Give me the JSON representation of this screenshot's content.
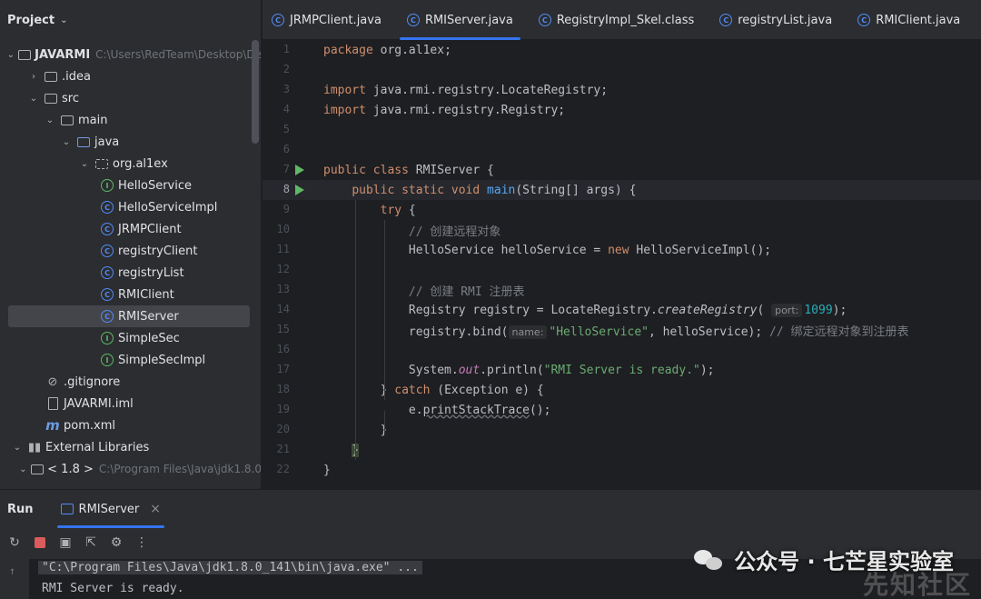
{
  "project": {
    "title": "Project",
    "tree": [
      {
        "label": "JAVARMI",
        "path": "C:\\Users\\RedTeam\\Desktop\\De",
        "depth": 0,
        "arrow": "down",
        "icon": "module-folder-icon",
        "bold": true
      },
      {
        "label": ".idea",
        "depth": 1,
        "arrow": "right",
        "icon": "folder-icon"
      },
      {
        "label": "src",
        "depth": 1,
        "arrow": "down",
        "icon": "folder-icon"
      },
      {
        "label": "main",
        "depth": 2,
        "arrow": "down",
        "icon": "folder-icon"
      },
      {
        "label": "java",
        "depth": 3,
        "arrow": "down",
        "icon": "source-folder-icon"
      },
      {
        "label": "org.al1ex",
        "depth": 4,
        "arrow": "down",
        "icon": "package-icon"
      },
      {
        "label": "HelloService",
        "depth": 5,
        "icon": "interface-icon"
      },
      {
        "label": "HelloServiceImpl",
        "depth": 5,
        "icon": "class-icon"
      },
      {
        "label": "JRMPClient",
        "depth": 5,
        "icon": "class-icon"
      },
      {
        "label": "registryClient",
        "depth": 5,
        "icon": "class-icon"
      },
      {
        "label": "registryList",
        "depth": 5,
        "icon": "class-icon"
      },
      {
        "label": "RMIClient",
        "depth": 5,
        "icon": "class-icon"
      },
      {
        "label": "RMIServer",
        "depth": 5,
        "icon": "class-icon",
        "selected": true
      },
      {
        "label": "SimpleSec",
        "depth": 5,
        "icon": "interface-icon"
      },
      {
        "label": "SimpleSecImpl",
        "depth": 5,
        "icon": "interface-icon"
      },
      {
        "label": ".gitignore",
        "depth": 2,
        "icon": "gitignore-icon"
      },
      {
        "label": "JAVARMI.iml",
        "depth": 2,
        "icon": "iml-file-icon"
      },
      {
        "label": "pom.xml",
        "depth": 2,
        "icon": "maven-icon"
      },
      {
        "label": "External Libraries",
        "depth": 0,
        "arrow": "down",
        "icon": "library-icon"
      },
      {
        "label": "< 1.8 >",
        "path": "C:\\Program Files\\Java\\jdk1.8.0",
        "depth": 1,
        "arrow": "down",
        "icon": "folder-icon"
      }
    ]
  },
  "tabs": [
    {
      "label": "JRMPClient.java",
      "active": false
    },
    {
      "label": "RMIServer.java",
      "active": true
    },
    {
      "label": "RegistryImpl_Skel.class",
      "active": false
    },
    {
      "label": "registryList.java",
      "active": false
    },
    {
      "label": "RMIClient.java",
      "active": false
    }
  ],
  "editor": {
    "current_line": 8,
    "line_numbers": [
      "1",
      "2",
      "3",
      "4",
      "5",
      "6",
      "7",
      "8",
      "9",
      "10",
      "11",
      "12",
      "13",
      "14",
      "15",
      "16",
      "17",
      "18",
      "19",
      "20",
      "21",
      "22"
    ],
    "runnable_lines": [
      7,
      8
    ],
    "hints": {
      "port": "port:",
      "name": "name:"
    },
    "code": {
      "pkg": "package",
      "pkg_name": " org.al1ex;",
      "imp": "import",
      "imp1": " java.rmi.registry.LocateRegistry;",
      "imp2": " java.rmi.registry.Registry;",
      "pub": "public",
      "cls": " class",
      "cls_name": " RMIServer {",
      "pub2": "public",
      "static": " static",
      "void": " void",
      "main": " main",
      "main_args": "(String[] args) {",
      "try": "try",
      "try_brace": " {",
      "cm1": "// 创建远程对象",
      "l11a": "HelloService helloService = ",
      "new": "new",
      "l11b": " HelloServiceImpl();",
      "cm2": "// 创建 RMI 注册表",
      "l14a": "Registry registry = LocateRegistry.",
      "createRegistry": "createRegistry",
      "l14b": "(",
      "port_val": "1099",
      "l14c": ");",
      "l15a": "registry.bind(",
      "l15str": "\"HelloService\"",
      "l15b": ", helloService); ",
      "cm3": "// 绑定远程对象到注册表",
      "l17a": "System.",
      "out": "out",
      "l17b": ".println(",
      "l17str": "\"RMI Server is ready.\"",
      "l17c": ");",
      "l18a": "} ",
      "catch": "catch",
      "l18b": " (Exception e) {",
      "l19a": "e.",
      "printStackTrace": "printStackTrace",
      "l19b": "();",
      "close": "}"
    }
  },
  "run": {
    "title": "Run",
    "tab_label": "RMIServer",
    "close": "×",
    "console": [
      "\"C:\\Program Files\\Java\\jdk1.8.0_141\\bin\\java.exe\" ...",
      "RMI Server is ready."
    ]
  },
  "watermark": {
    "text": "公众号 · 七芒星实验室",
    "text2": "先知社区"
  }
}
